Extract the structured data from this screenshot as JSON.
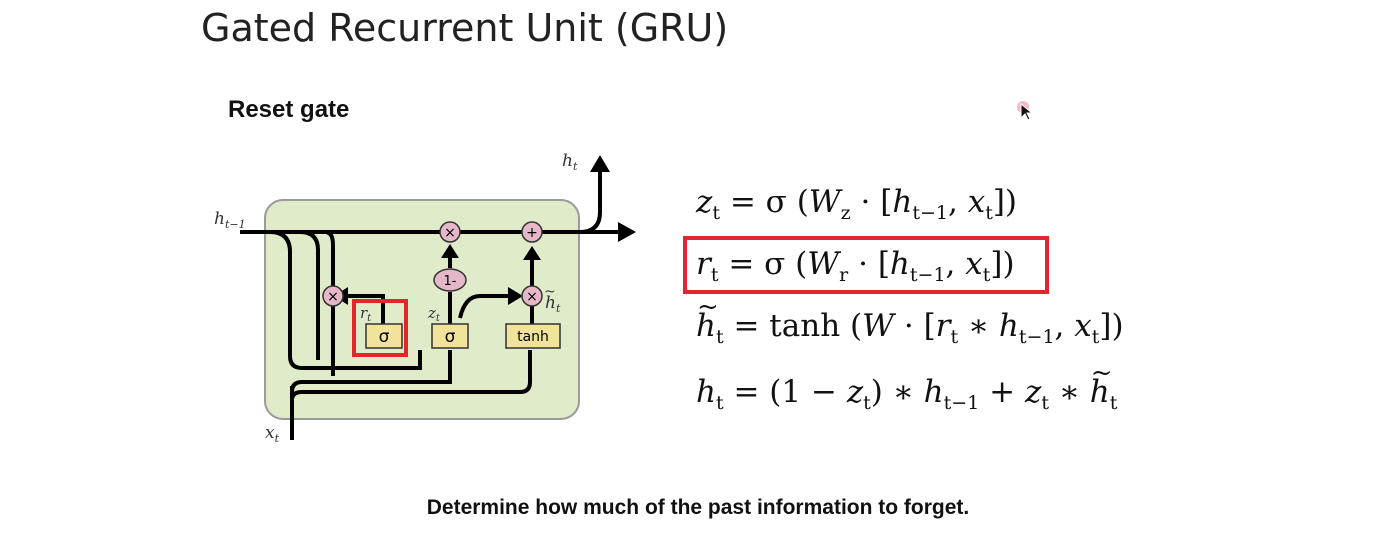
{
  "slide": {
    "title": "Gated Recurrent Unit (GRU)",
    "subtitle": "Reset gate",
    "caption": "Determine how much of the past information to forget."
  },
  "diagram": {
    "input_label": "x",
    "input_sub": "t",
    "hidden_in_label": "h",
    "hidden_in_sub": "t−1",
    "hidden_out_label": "h",
    "hidden_out_sub": "t",
    "gate_sigma_r": "σ",
    "gate_sigma_z": "σ",
    "gate_tanh": "tanh",
    "r_label": "r",
    "r_sub": "t",
    "z_label": "z",
    "z_sub": "t",
    "htilde_label": "h",
    "htilde_sub": "t",
    "op_multiply": "×",
    "op_add": "+",
    "op_one_minus": "1-"
  },
  "equations": {
    "eq1": {
      "lhs": "z",
      "lhs_sub": "t",
      "rhs_a": "= σ (",
      "w": "W",
      "w_sub": "z",
      "rhs_b": "· [",
      "h": "h",
      "h_sub": "t−1",
      "comma": ", ",
      "x": "x",
      "x_sub": "t",
      "close": "])"
    },
    "eq2": {
      "lhs": "r",
      "lhs_sub": "t",
      "rhs_a": "= σ (",
      "w": "W",
      "w_sub": "r",
      "rhs_b": "· [",
      "h": "h",
      "h_sub": "t−1",
      "comma": ", ",
      "x": "x",
      "x_sub": "t",
      "close": "])"
    },
    "eq3": {
      "lhs": "h",
      "lhs_sub": "t",
      "rhs_a": "= tanh (",
      "w": "W",
      "rhs_b": "· [",
      "r": "r",
      "r_sub": "t",
      "star": " ∗ ",
      "h": "h",
      "h_sub": "t−1",
      "comma": ", ",
      "x": "x",
      "x_sub": "t",
      "close": "])"
    },
    "eq4": {
      "lhs": "h",
      "lhs_sub": "t",
      "rhs_a": "= (1 − ",
      "z": "z",
      "z_sub": "t",
      "rhs_b": ") ∗ ",
      "h": "h",
      "h_sub": "t−1",
      "plus": " + ",
      "z2": "z",
      "z2_sub": "t",
      "star": " ∗ ",
      "ht": "h",
      "ht_sub": "t"
    }
  },
  "colors": {
    "cell_fill": "#dfebc9",
    "cell_stroke": "#9a9a9a",
    "gate_fill": "#f1e39a",
    "op_fill": "#e5b7c8",
    "highlight": "#e2262b"
  }
}
